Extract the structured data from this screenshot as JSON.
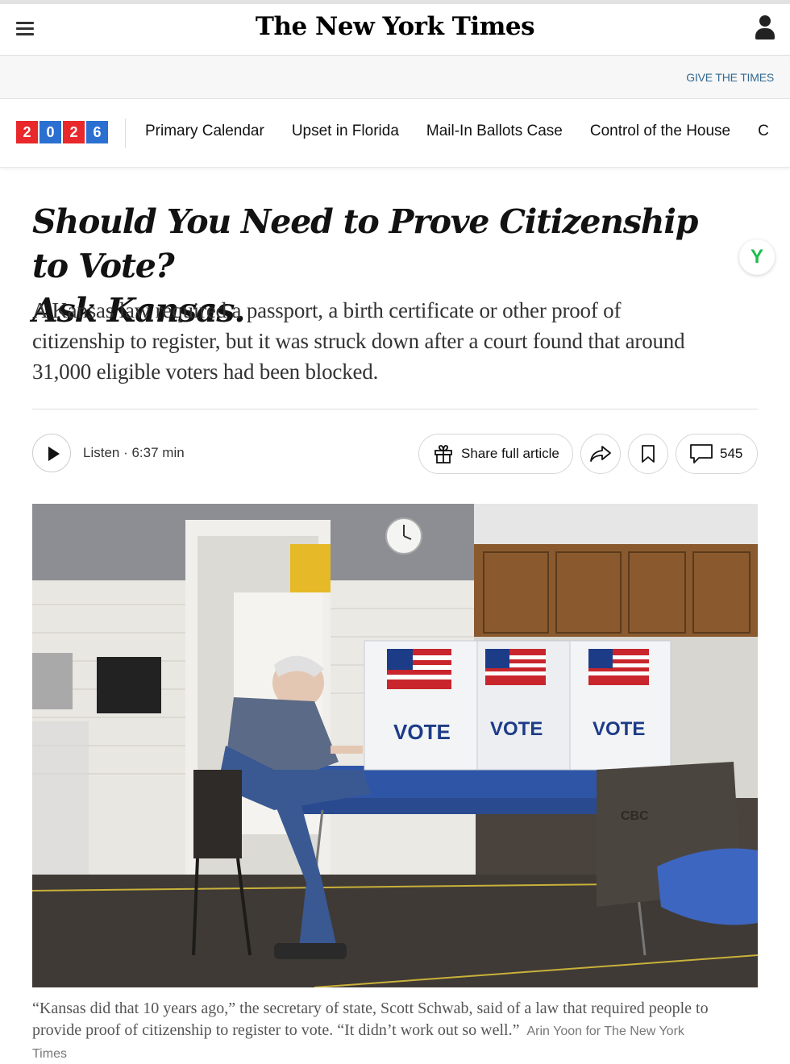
{
  "masthead": {
    "logo": "The New York Times",
    "menu_icon": "hamburger-menu-icon",
    "account_icon": "person-icon"
  },
  "subbar": {
    "give_link": "GIVE THE TIMES"
  },
  "nav": {
    "badge": {
      "digits": [
        "2",
        "0",
        "2",
        "6"
      ],
      "colors": [
        "#e8282b",
        "#2b6fd1",
        "#e8282b",
        "#2b6fd1"
      ]
    },
    "items": [
      "Primary Calendar",
      "Upset in Florida",
      "Mail-In Ballots Case",
      "Control of the House",
      "C"
    ]
  },
  "article": {
    "headline_line1": "Should You Need to Prove Citizenship to Vote?",
    "headline_line2": "Ask Kansas.",
    "summary": "A Kansas law required a passport, a birth certificate or other proof of citizenship to register, but it was struck down after a court found that around 31,000 eligible voters had been blocked.",
    "y_badge": "Y"
  },
  "toolbar": {
    "listen": "Listen · 6:37 min",
    "share": "Share full article",
    "comments_count": "545"
  },
  "photo": {
    "booth_text": [
      "VOTE",
      "VOTE",
      "VOTE"
    ],
    "chair_text": "CBC"
  },
  "caption": {
    "text": "“Kansas did that 10 years ago,” the secretary of state, Scott Schwab, said of a law that required people to provide proof of citizenship to register to vote. “It didn’t work out so well.”",
    "credit": "Arin Yoon for The New York Times"
  },
  "colors": {
    "link": "#326891",
    "green_badge": "#1ebd4c"
  }
}
